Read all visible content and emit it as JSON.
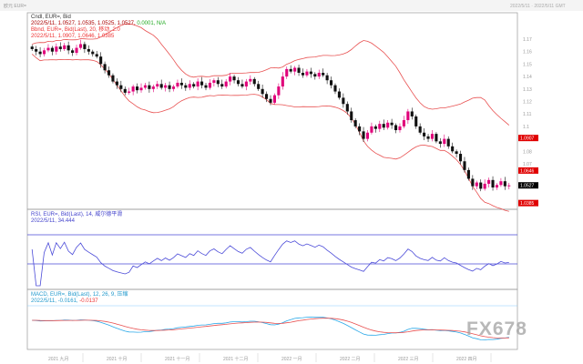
{
  "window": {
    "title": "欧元 EUR=",
    "status": "2022/5/11 · 2022/5/11 GMT"
  },
  "legend": {
    "cndl_title": "Cndl, EUR=, Bid",
    "cndl_values": "2022/5/11, 1.0527, 1.0535, 1.0525, 1.0527,",
    "cndl_change": "0.0001, N/A",
    "bb_title": "Bbnd, EUR=, Bid(Last), 20, 移动, 2.0",
    "bb_values": "2022/5/11, 1.0907, 1.0646, 1.0385",
    "rsi_title": "RSI, EUR=, Bid(Last), 14, 威尔德平滑",
    "rsi_values": "2022/5/11, 34.444",
    "macd_title": "MACD, EUR=, Bid(Last), 12, 26, 9, 压缩",
    "macd_values": "2022/5/11, -0.0161,",
    "macd_signal": "-0.0137"
  },
  "watermark": "FX678",
  "colors": {
    "up": "#e0007a",
    "down": "#111111",
    "band": "#e85050",
    "rsi": "#4a4ad8",
    "macd": "#2aa8e8",
    "signal": "#e85050",
    "tag_red": "#e00000",
    "tag_black": "#000000"
  },
  "chart_data": {
    "type": "candlestick",
    "title": "EUR= Bid",
    "y_ticks": [
      "1.17",
      "1.16",
      "1.15",
      "1.14",
      "1.13",
      "1.12",
      "1.11",
      "1.1",
      "1.09",
      "1.08",
      "1.07"
    ],
    "ylim": [
      1.035,
      1.172
    ],
    "price_tags": [
      {
        "label": "1.0907",
        "value": 1.0907,
        "color": "red"
      },
      {
        "label": "1.0646",
        "value": 1.0646,
        "color": "red"
      },
      {
        "label": "1.0527",
        "value": 1.0527,
        "color": "black"
      },
      {
        "label": "1.0385",
        "value": 1.0385,
        "color": "red"
      }
    ],
    "x_labels": [
      "2021 九月",
      "2021 十月",
      "2021 十一月",
      "2021 十二月",
      "2022 一月",
      "2022 二月",
      "2022 三月",
      "2022 四月"
    ],
    "rsi": {
      "levels": [
        70,
        30
      ],
      "last": 34.444
    },
    "closes": [
      1.162,
      1.16,
      1.158,
      1.161,
      1.163,
      1.16,
      1.164,
      1.162,
      1.165,
      1.161,
      1.159,
      1.163,
      1.166,
      1.162,
      1.16,
      1.158,
      1.156,
      1.15,
      1.145,
      1.141,
      1.136,
      1.133,
      1.13,
      1.127,
      1.128,
      1.132,
      1.129,
      1.131,
      1.133,
      1.13,
      1.132,
      1.134,
      1.131,
      1.133,
      1.13,
      1.132,
      1.135,
      1.133,
      1.131,
      1.134,
      1.132,
      1.136,
      1.133,
      1.131,
      1.135,
      1.137,
      1.134,
      1.132,
      1.136,
      1.14,
      1.137,
      1.134,
      1.132,
      1.136,
      1.138,
      1.134,
      1.13,
      1.126,
      1.122,
      1.119,
      1.125,
      1.132,
      1.14,
      1.146,
      1.144,
      1.147,
      1.143,
      1.141,
      1.144,
      1.142,
      1.14,
      1.143,
      1.141,
      1.137,
      1.133,
      1.128,
      1.123,
      1.118,
      1.112,
      1.105,
      1.1,
      1.096,
      1.09,
      1.095,
      1.1,
      1.098,
      1.102,
      1.099,
      1.103,
      1.101,
      1.097,
      1.1,
      1.105,
      1.112,
      1.108,
      1.1,
      1.095,
      1.092,
      1.09,
      1.094,
      1.088,
      1.086,
      1.09,
      1.084,
      1.08,
      1.078,
      1.072,
      1.065,
      1.058,
      1.052,
      1.055,
      1.05,
      1.054,
      1.057,
      1.051,
      1.053,
      1.056,
      1.052,
      1.0527
    ]
  }
}
